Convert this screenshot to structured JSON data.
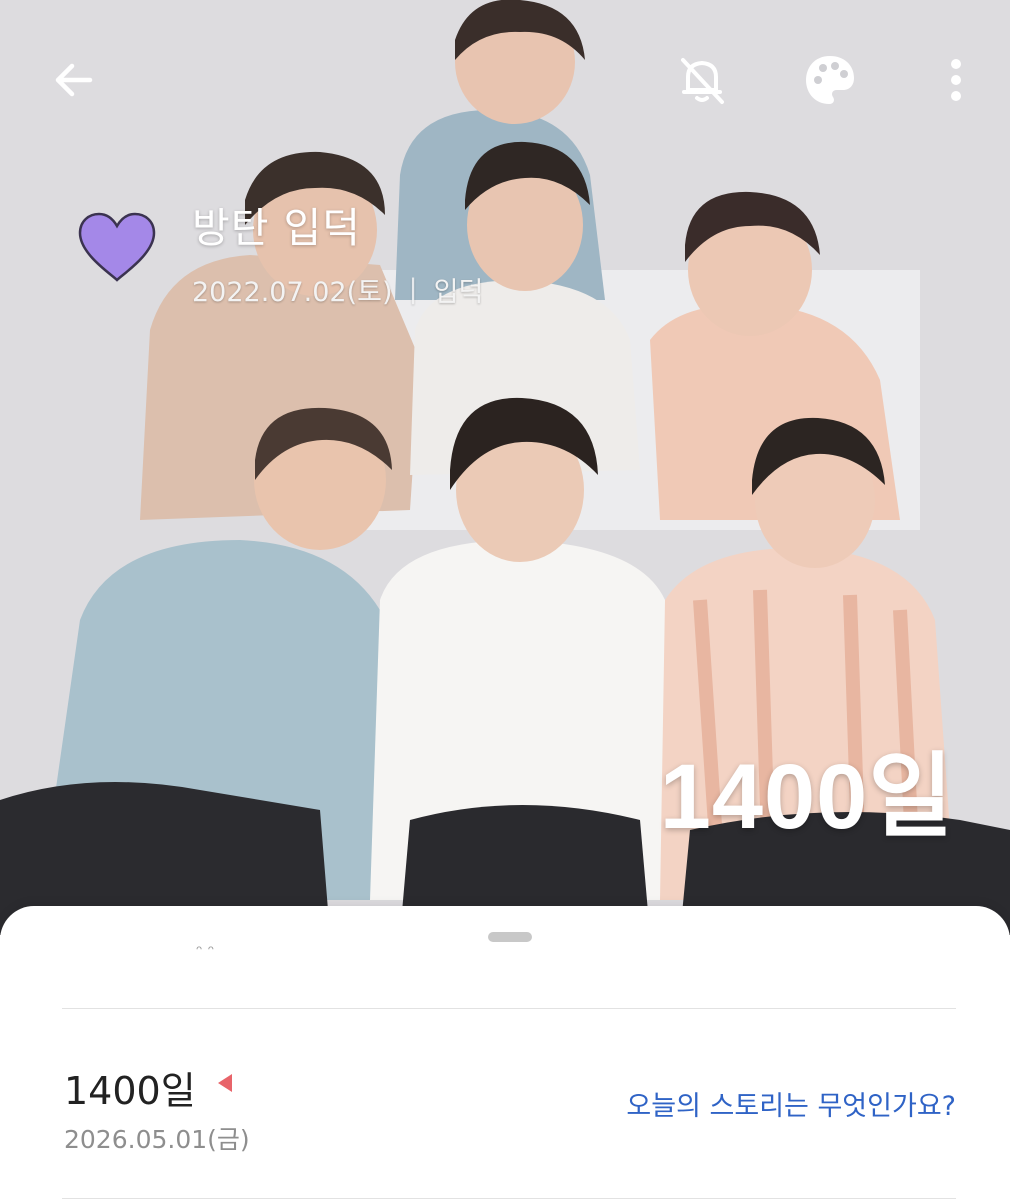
{
  "header": {
    "back_icon": "arrow-left-icon",
    "mute_icon": "bell-off-icon",
    "palette_icon": "palette-icon",
    "more_icon": "more-vertical-icon"
  },
  "dday": {
    "icon": "heart-icon",
    "icon_color": "#a488e8",
    "title": "방탄 입덕",
    "start_date": "2022.07.02(토)",
    "separator": "|",
    "tag": "입덕",
    "count": "1400일"
  },
  "sheet": {
    "peek_text": "ᵔ ᵔ",
    "entry": {
      "count": "1400일",
      "date": "2026.05.01(금)",
      "flag_color": "#e8646a",
      "story_prompt": "오늘의 스토리는 무엇인가요?"
    }
  },
  "colors": {
    "link": "#2f63c6"
  }
}
